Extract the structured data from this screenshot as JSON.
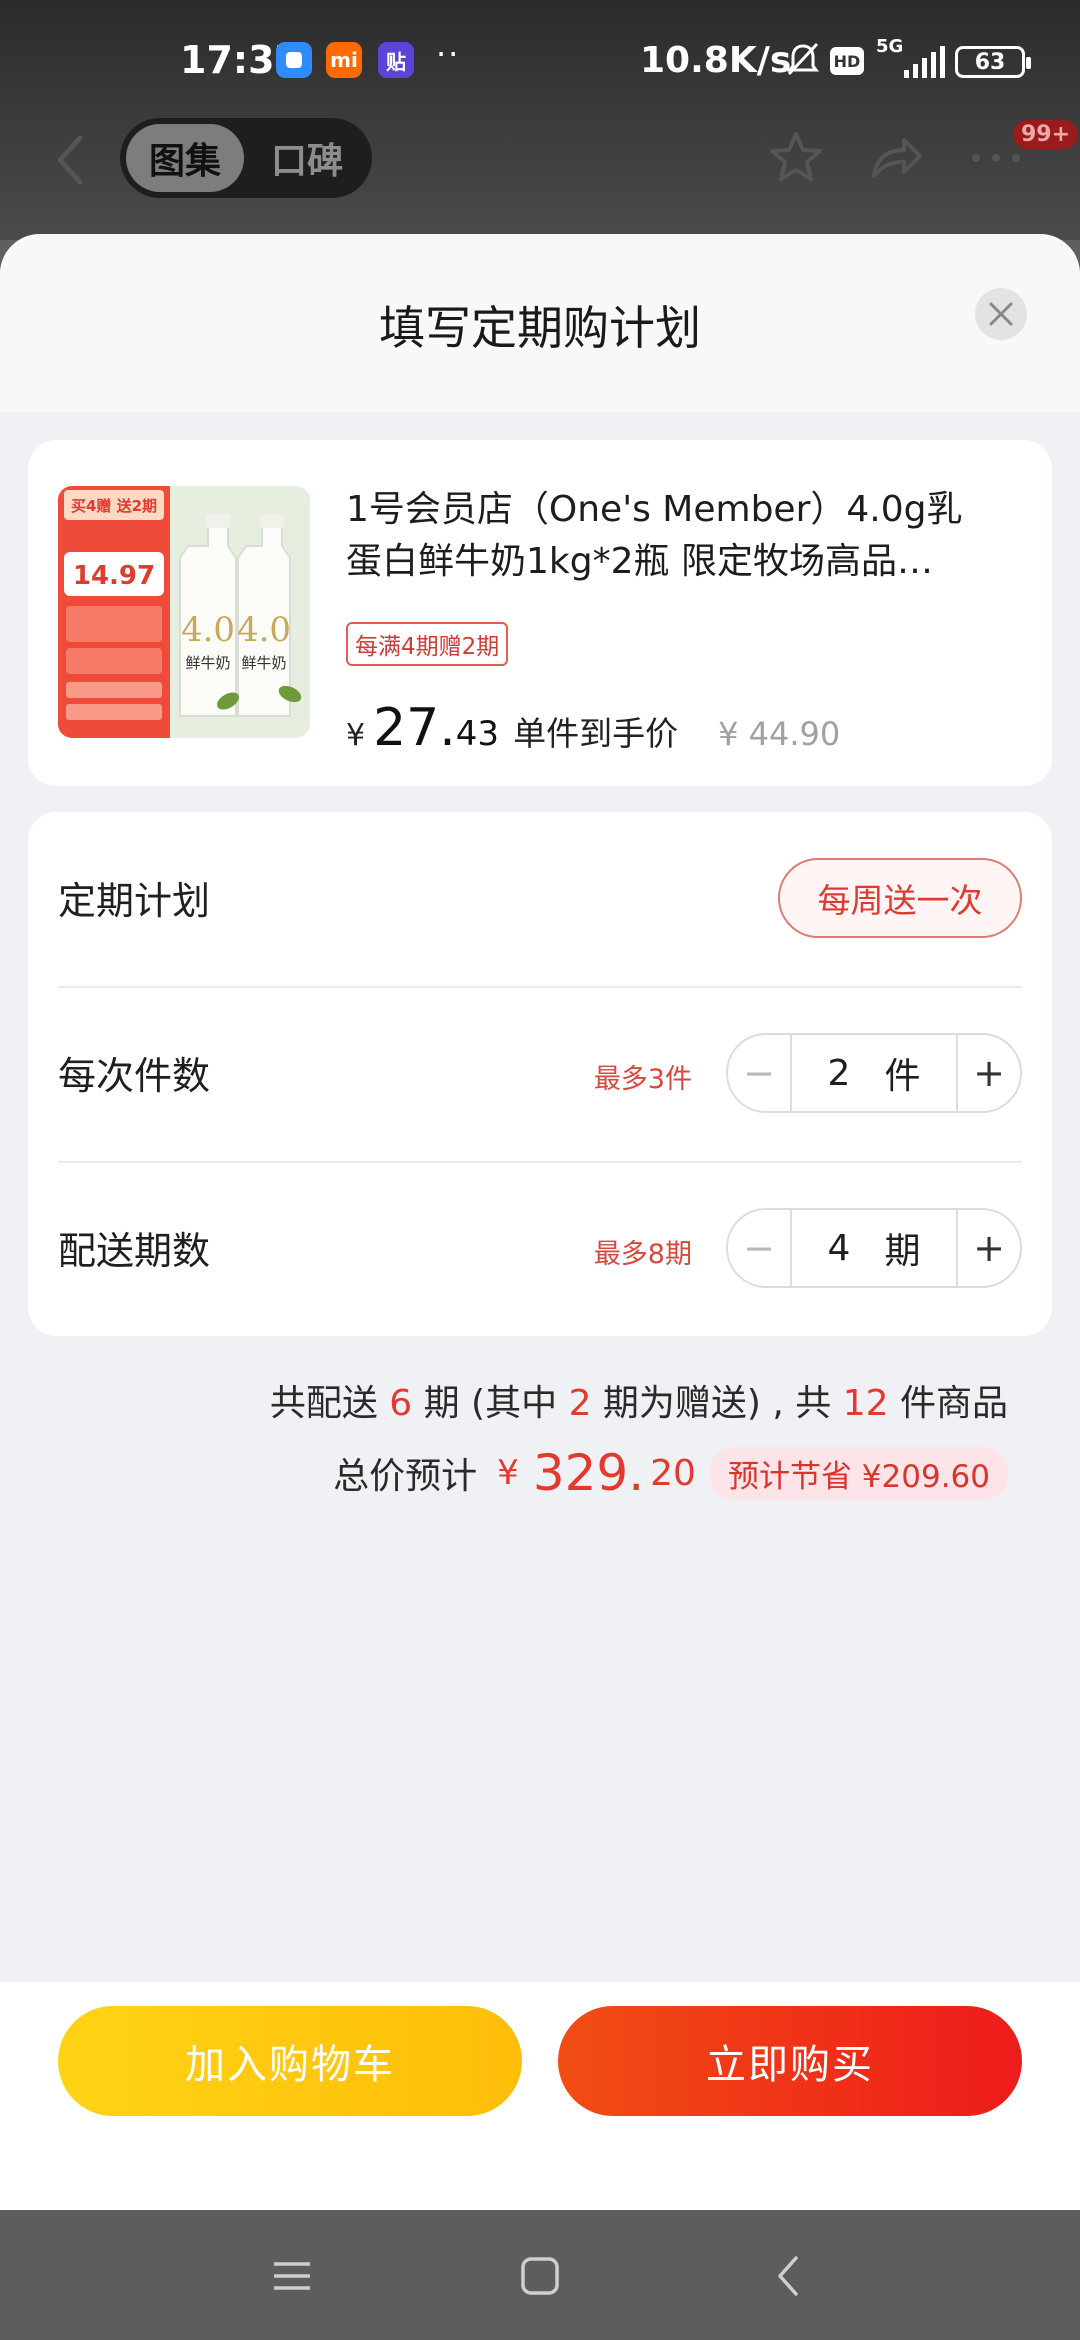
{
  "status_bar": {
    "time": "17:37",
    "apps": [
      {
        "name": "blue-app-icon",
        "glyph": "",
        "color": "#2f8cff"
      },
      {
        "name": "mi-app-icon",
        "glyph": "mi",
        "color": "#ff6a00"
      },
      {
        "name": "tie-app-icon",
        "glyph": "贴",
        "color": "#5b45d8"
      }
    ],
    "more_dots": "··",
    "network_speed": "10.8K/s",
    "hd_label": "HD",
    "network_type": "5G",
    "battery": "63"
  },
  "top_nav": {
    "tab_active": "图集",
    "tab_inactive": "口碑",
    "notification_badge": "99+"
  },
  "sheet": {
    "title": "填写定期购计划"
  },
  "product": {
    "name_line1": "1号会员店（One's Member）4.0g乳",
    "name_line2": "蛋白鲜牛奶1kg*2瓶 限定牧场高品…",
    "promo_tag": "每满4期赠2期",
    "currency": "¥",
    "price_int": "27.",
    "price_dec": "43",
    "price_label": "单件到手价",
    "original_price": "¥ 44.90",
    "thumb": {
      "banner": "买4赠 送2期",
      "price": "14.97",
      "bottle_label": "鲜牛奶",
      "bottle_mark": "4.0"
    }
  },
  "plan": {
    "frequency_label": "定期计划",
    "frequency_value": "每周送一次",
    "qty_label": "每次件数",
    "qty_max": "最多3件",
    "qty_value": "2",
    "qty_unit": "件",
    "periods_label": "配送期数",
    "periods_max": "最多8期",
    "periods_value": "4",
    "periods_unit": "期",
    "minus": "−",
    "plus": "+"
  },
  "summary": {
    "p1": "共配送 ",
    "total_periods": "6",
    "p2": " 期 (其中 ",
    "gift_periods": "2",
    "p3": " 期为赠送) , 共 ",
    "total_items": "12",
    "p4": " 件商品",
    "total_label": "总价预计",
    "total_currency": "¥",
    "total_int": "329.",
    "total_dec": "20",
    "savings": "预计节省 ¥209.60"
  },
  "actions": {
    "add_to_cart": "加入购物车",
    "buy_now": "立即购买"
  },
  "colors": {
    "accent_red": "#e23a2f",
    "cart_yellow": "#ffc70f",
    "buy_red": "#ef3117"
  }
}
